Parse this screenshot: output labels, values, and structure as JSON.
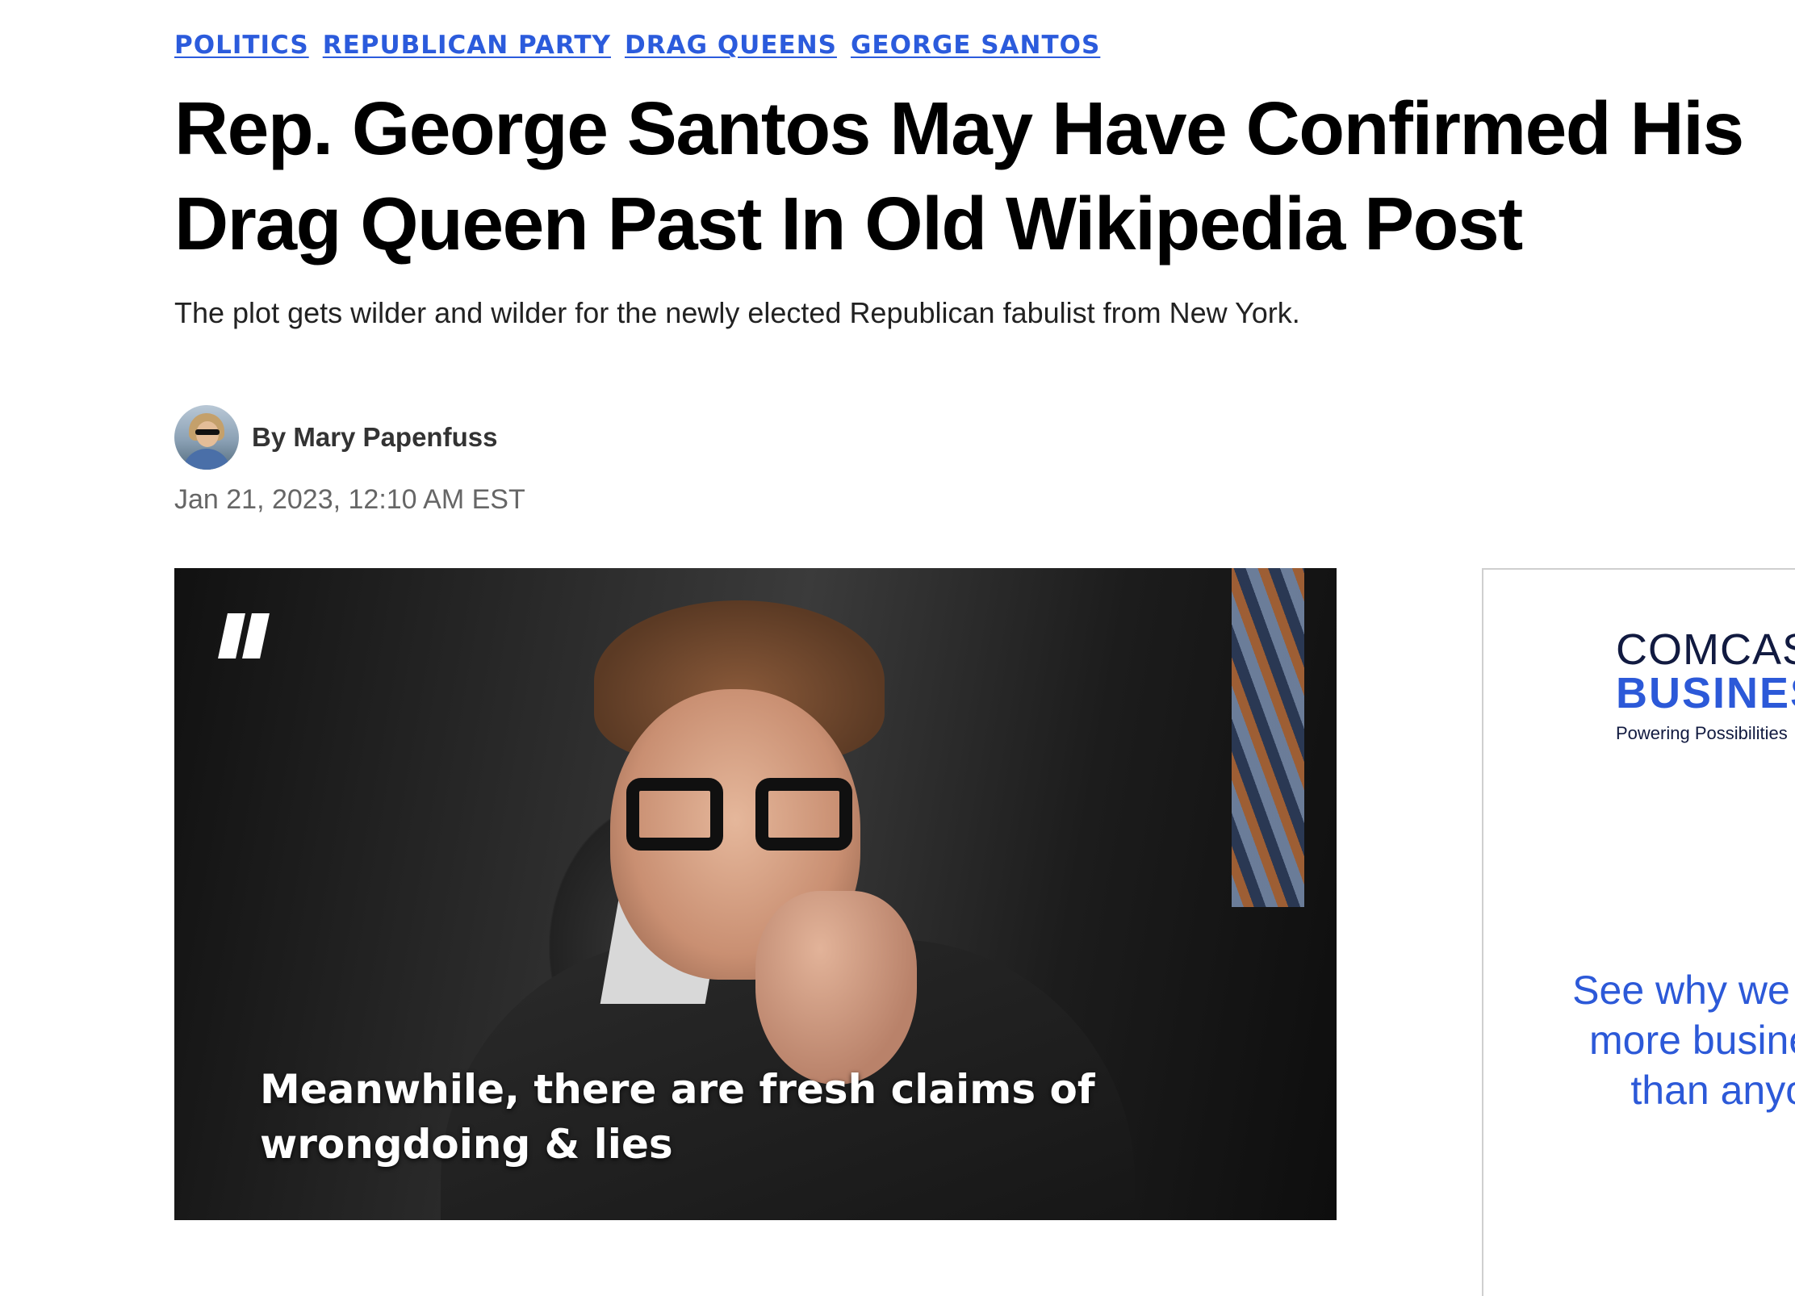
{
  "tags": [
    "POLITICS",
    "REPUBLICAN PARTY",
    "DRAG QUEENS",
    "GEORGE SANTOS"
  ],
  "headline": {
    "line1": "Rep. George Santos May Have Confirmed His",
    "line2": "Drag Queen Past In Old Wikipedia Post"
  },
  "dek": "The plot gets wilder and wilder for the newly elected Republican fabulist from New York.",
  "byline": "By Mary Papenfuss",
  "timestamp": "Jan 21, 2023, 12:10 AM EST",
  "video": {
    "caption_line1": "Meanwhile, there are fresh claims of",
    "caption_line2": "wrongdoing & lies"
  },
  "ad": {
    "brand_line1": "COMCAST",
    "brand_line2": "BUSINESS",
    "tagline": "Powering Possibilities",
    "pitch_line1": "See why we power",
    "pitch_line2": "more businesses",
    "pitch_line3": "than anyone"
  },
  "colors": {
    "link": "#2b5bdc",
    "ad_blue": "#2c59d8",
    "ad_navy": "#111a40"
  }
}
